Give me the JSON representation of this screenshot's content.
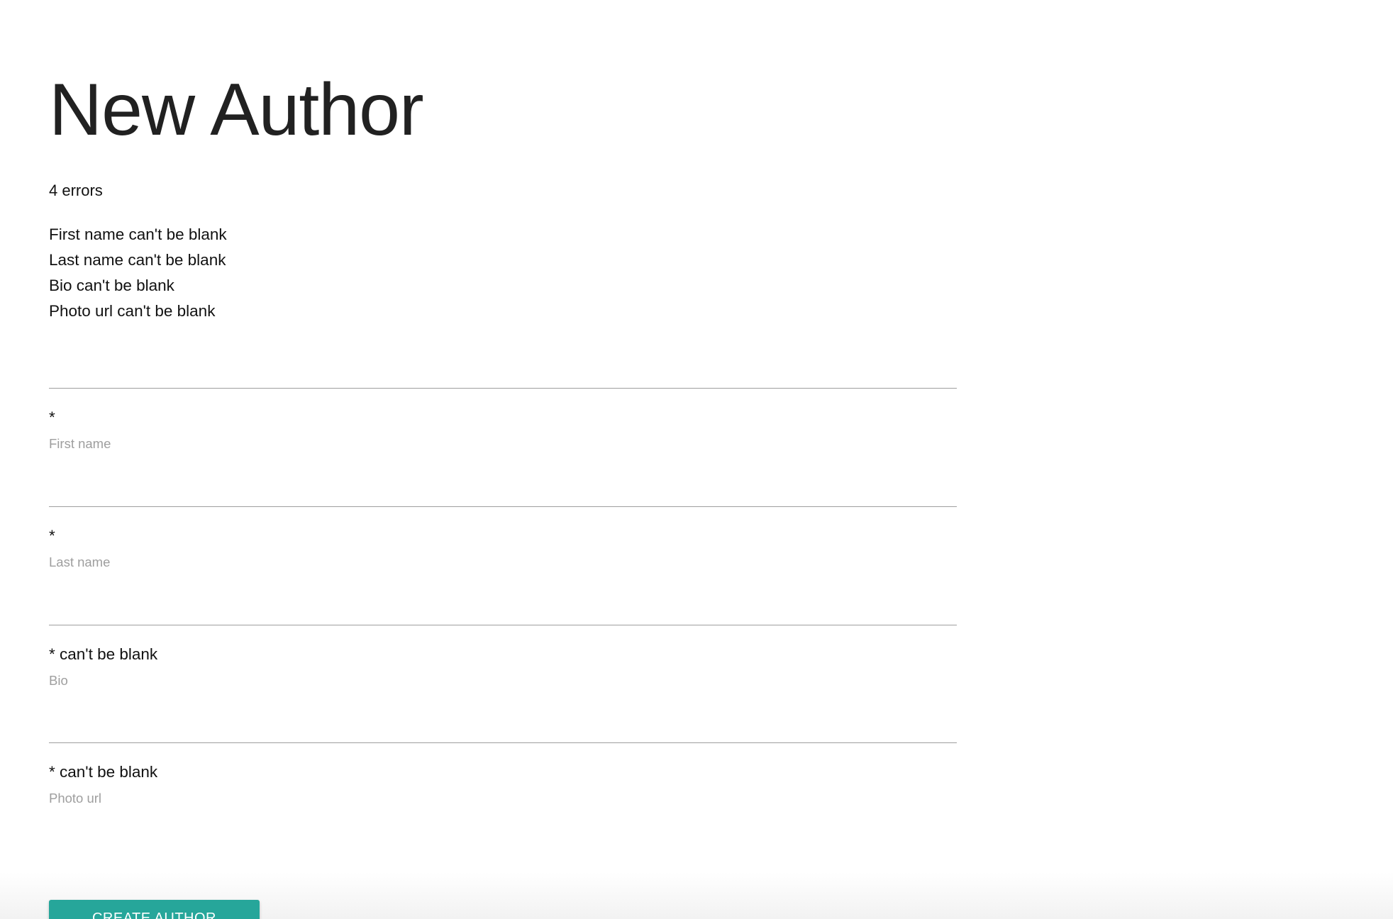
{
  "page": {
    "title": "New Author"
  },
  "errors": {
    "count_text": "4 errors",
    "messages": [
      "First name can't be blank",
      "Last name can't be blank",
      "Bio can't be blank",
      "Photo url can't be blank"
    ]
  },
  "form": {
    "fields": [
      {
        "label": "First name",
        "helper": "*",
        "value": ""
      },
      {
        "label": "Last name",
        "helper": "*",
        "value": ""
      },
      {
        "label": "Bio",
        "helper": "* can't be blank",
        "value": ""
      },
      {
        "label": "Photo url",
        "helper": "* can't be blank",
        "value": ""
      }
    ],
    "submit_label": "Create Author"
  },
  "colors": {
    "button": "#26a69a",
    "label": "#9e9e9e",
    "underline": "#9e9e9e"
  }
}
